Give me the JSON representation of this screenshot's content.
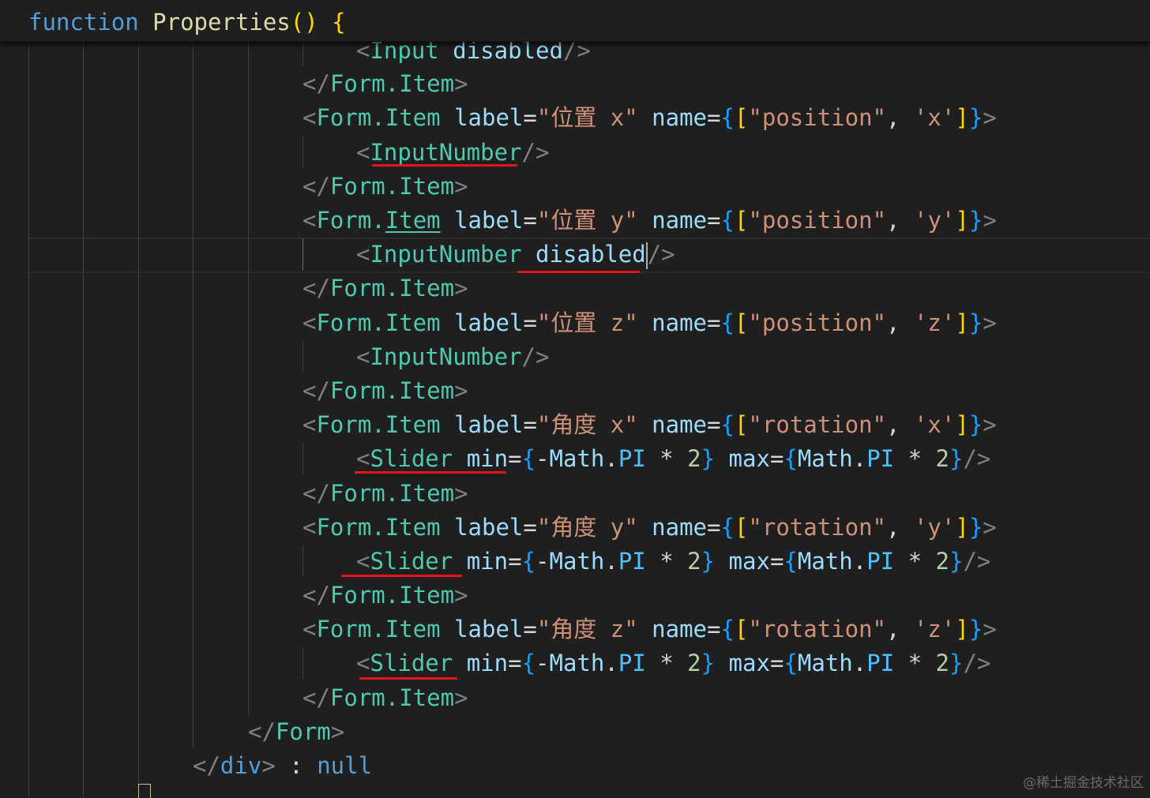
{
  "header": {
    "keyword": "function",
    "name": "Properties",
    "parens": "()",
    "brace": "{"
  },
  "tokens": {
    "lt": "<",
    "lt_slash": "</",
    "gt": ">",
    "self_close": "/>",
    "form_item": "Form.Item",
    "form": "Form",
    "form_prefix": "Form.",
    "item": "Item",
    "label": "label",
    "name": "name",
    "eq": "=",
    "brace_open": "{",
    "brace_close": "}",
    "bracket_open": "[",
    "bracket_close": "]",
    "comma": ",",
    "input": "Input",
    "disabled": "disabled",
    "input_number": "InputNumber",
    "slider": "Slider",
    "min": "min",
    "max": "max",
    "minus": "-",
    "math": "Math",
    "dot": ".",
    "pi": "PI",
    "times": "*",
    "two": "2",
    "div": "div",
    "colon": ":",
    "null": "null",
    "q_position": "\"position\"",
    "q_rotation": "\"rotation\"",
    "s_x": "'x'",
    "s_y": "'y'",
    "s_z": "'z'",
    "lbl_pos_x": "\"位置 x\"",
    "lbl_pos_y": "\"位置 y\"",
    "lbl_pos_z": "\"位置 z\"",
    "lbl_rot_x": "\"角度 x\"",
    "lbl_rot_y": "\"角度 y\"",
    "lbl_rot_z": "\"角度 z\""
  },
  "watermark": "@稀土掘金技术社区",
  "colors": {
    "background": "#1f1f1f",
    "keyword": "#569cd6",
    "function": "#dcdcaa",
    "tag": "#4ec9b0",
    "attribute": "#9cdcfe",
    "string": "#ce9178",
    "constant": "#4fc1ff",
    "number": "#b5cea8",
    "bracket_gold": "#ffd700",
    "bracket_purple": "#da70d6",
    "bracket_blue": "#179fff",
    "annotation_red": "#e8161b"
  }
}
